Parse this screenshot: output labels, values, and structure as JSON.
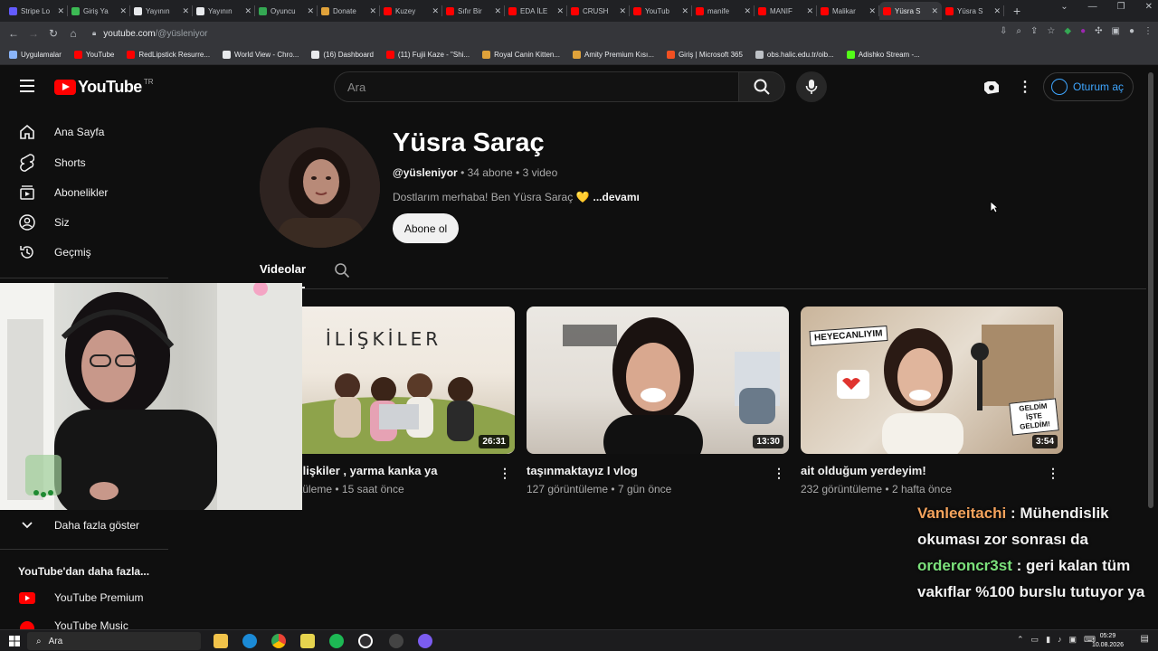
{
  "browser": {
    "tabs": [
      {
        "title": "Stripe Lo",
        "color": "#635bff"
      },
      {
        "title": "Giriş Ya",
        "color": "#3cba54"
      },
      {
        "title": "Yayının",
        "color": "#e8eaed"
      },
      {
        "title": "Yayının",
        "color": "#e8eaed"
      },
      {
        "title": "Oyuncu",
        "color": "#34a853"
      },
      {
        "title": "Donate",
        "color": "#e0a23a"
      },
      {
        "title": "Kuzey",
        "color": "#ff0000"
      },
      {
        "title": "Sıfır Bir",
        "color": "#ff0000"
      },
      {
        "title": "EDA İLE",
        "color": "#ff0000"
      },
      {
        "title": "CRUSH",
        "color": "#ff0000"
      },
      {
        "title": "YouTub",
        "color": "#ff0000"
      },
      {
        "title": "manife",
        "color": "#ff0000"
      },
      {
        "title": "MANIF",
        "color": "#ff0000"
      },
      {
        "title": "Malikar",
        "color": "#ff0000"
      },
      {
        "title": "Yüsra S",
        "color": "#ff0000",
        "active": true
      },
      {
        "title": "Yüsra S",
        "color": "#ff0000"
      }
    ],
    "url_host": "youtube.com",
    "url_path": "/@yüsleniyor",
    "bookmarks": [
      {
        "label": "Uygulamalar",
        "color": "#8ab4f8"
      },
      {
        "label": "YouTube",
        "color": "#ff0000"
      },
      {
        "label": "RedLipstick Resurre...",
        "color": "#ff0000"
      },
      {
        "label": "World View - Chro...",
        "color": "#e8eaed"
      },
      {
        "label": "(16) Dashboard",
        "color": "#e8eaed"
      },
      {
        "label": "(11) Fujii Kaze - \"Shi...",
        "color": "#ff0000"
      },
      {
        "label": "Royal Canin Kitten...",
        "color": "#e0a23a"
      },
      {
        "label": "Amity Premium Kısı...",
        "color": "#e0a23a"
      },
      {
        "label": "Giriş | Microsoft 365",
        "color": "#f25022"
      },
      {
        "label": "obs.halic.edu.tr/oib...",
        "color": "#bdc1c6"
      },
      {
        "label": "Adishko Stream -...",
        "color": "#53fc18"
      }
    ]
  },
  "header": {
    "logo_text": "YouTube",
    "country": "TR",
    "search_placeholder": "Ara",
    "signin_label": "Oturum aç"
  },
  "sidebar": {
    "items": [
      {
        "label": "Ana Sayfa",
        "icon": "home-icon"
      },
      {
        "label": "Shorts",
        "icon": "shorts-icon"
      },
      {
        "label": "Abonelikler",
        "icon": "subscriptions-icon"
      },
      {
        "label": "Siz",
        "icon": "you-icon"
      },
      {
        "label": "Geçmiş",
        "icon": "history-icon"
      }
    ],
    "show_more": "Daha fazla göster",
    "section_title": "YouTube'dan daha fazla...",
    "more_items": [
      {
        "label": "YouTube Premium"
      },
      {
        "label": "YouTube Music"
      }
    ]
  },
  "channel": {
    "name": "Yüsra Saraç",
    "handle": "@yüsleniyor",
    "subscribers": "34 abone",
    "video_count": "3 video",
    "description": "Dostlarım merhaba! Ben Yüsra Saraç 💛",
    "more_label": "...devamı",
    "subscribe_label": "Abone ol",
    "tab_videos": "Videolar"
  },
  "videos": [
    {
      "title": "ilişkiler , yarma kanka ya",
      "views": "tüleme",
      "age": "15 saat önce",
      "duration": "26:31",
      "thumb_text": "İLİŞKİLER"
    },
    {
      "title": "taşınmaktayız I vlog",
      "views": "127 görüntüleme",
      "age": "7 gün önce",
      "duration": "13:30"
    },
    {
      "title": "ait olduğum yerdeyim!",
      "views": "232 görüntüleme",
      "age": "2 hafta önce",
      "duration": "3:54",
      "thumb_text": "HEYECANLIYIM",
      "thumb_text2": "GELDİM İŞTE GELDİM!"
    }
  ],
  "chat": [
    {
      "user": "Vanleeitachi",
      "message": "Mühendislik okuması zor sonrası da"
    },
    {
      "user": "orderoncr3st",
      "message": "geri kalan tüm vakıflar %100 burslu tutuyor ya"
    }
  ],
  "taskbar": {
    "search_label": "Ara",
    "time": "05:29",
    "date": "10.08.2026"
  }
}
